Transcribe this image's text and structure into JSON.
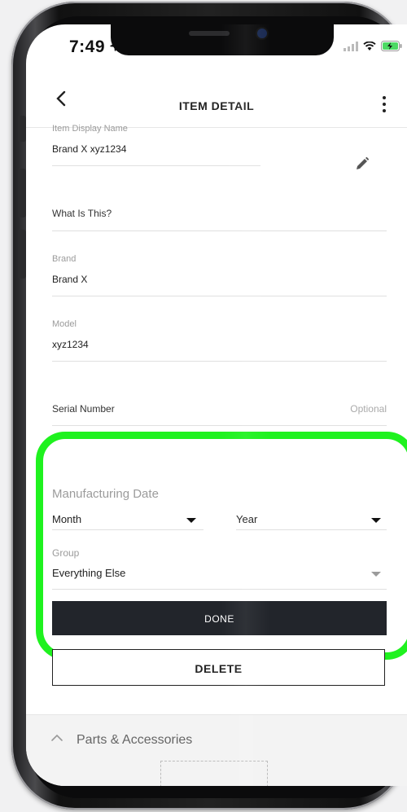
{
  "status_bar": {
    "time": "7:49"
  },
  "header": {
    "title": "ITEM DETAIL"
  },
  "fields": {
    "display_name": {
      "label": "Item Display Name",
      "value": "Brand X xyz1234"
    },
    "what_is_this": {
      "label": "What Is This?"
    },
    "brand": {
      "label": "Brand",
      "value": "Brand X"
    },
    "model": {
      "label": "Model",
      "value": "xyz1234"
    },
    "serial_number": {
      "label": "Serial Number",
      "hint": "Optional"
    }
  },
  "manufacturing": {
    "title": "Manufacturing Date",
    "month": "Month",
    "year": "Year"
  },
  "group": {
    "label": "Group",
    "value": "Everything Else"
  },
  "buttons": {
    "done": "DONE",
    "delete": "DELETE"
  },
  "parts": {
    "label": "Parts & Accessories"
  },
  "colors": {
    "highlight": "#1ff21f",
    "done_bg": "#22252b"
  }
}
